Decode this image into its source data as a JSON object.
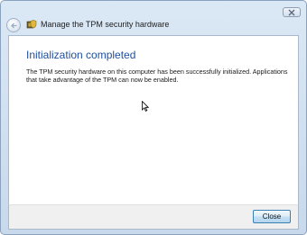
{
  "window": {
    "title": "Manage the TPM security hardware"
  },
  "content": {
    "heading": "Initialization completed",
    "message": "The TPM security hardware on this computer has been successfully initialized. Applications that take advantage of the TPM can now be enabled."
  },
  "footer": {
    "close_label": "Close"
  },
  "icons": {
    "back": "back-arrow-icon",
    "title": "tpm-chip-shield-icon",
    "window_close": "close-icon",
    "cursor": "mouse-cursor-icon"
  },
  "colors": {
    "heading": "#1e4e9c",
    "frame": "#c8d9ec",
    "button_border": "#3c7fb1"
  }
}
